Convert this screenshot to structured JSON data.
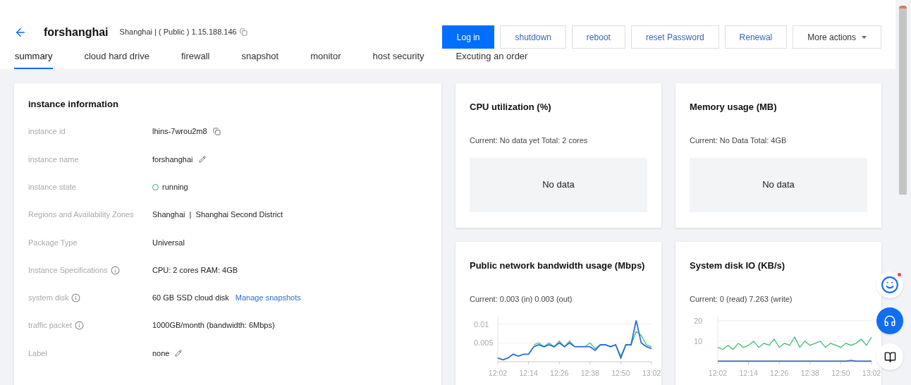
{
  "header": {
    "title": "forshanghai",
    "subtitle": "Shanghai | ( Public ) 1.15.188.146"
  },
  "buttons": [
    {
      "label": "Log in",
      "kind": "primary"
    },
    {
      "label": "shutdown",
      "kind": "outline"
    },
    {
      "label": "reboot",
      "kind": "outline"
    },
    {
      "label": "reset Password",
      "kind": "outline"
    },
    {
      "label": "Renewal",
      "kind": "outline"
    },
    {
      "label": "More actions",
      "kind": "dropdown"
    }
  ],
  "tabs": [
    {
      "label": "summary",
      "selected": true
    },
    {
      "label": "cloud hard drive",
      "selected": false
    },
    {
      "label": "firewall",
      "selected": false
    },
    {
      "label": "snapshot",
      "selected": false
    },
    {
      "label": "monitor",
      "selected": false
    },
    {
      "label": "host security",
      "selected": false
    },
    {
      "label": "Excuting an order",
      "selected": false
    }
  ],
  "instance_info": {
    "title": "instance information",
    "rows": [
      {
        "label": "instance id",
        "info": false,
        "value": "lhins-7wrou2m8",
        "kind": "copyable"
      },
      {
        "label": "instance name",
        "info": false,
        "value": "forshanghai",
        "kind": "editable"
      },
      {
        "label": "instance state",
        "info": false,
        "value": "running",
        "kind": "status"
      },
      {
        "label": "Regions and Availability Zones",
        "info": false,
        "value": "Shanghai  |  Shanghai Second District",
        "kind": "plain"
      },
      {
        "label": "Package Type",
        "info": false,
        "value": "Universal",
        "kind": "plain"
      },
      {
        "label": "Instance Specifications",
        "info": true,
        "value": "CPU: 2 cores RAM: 4GB",
        "kind": "plain"
      },
      {
        "label": "system disk",
        "info": true,
        "value": "60 GB SSD cloud disk",
        "link": "Manage snapshots",
        "kind": "plain"
      },
      {
        "label": "traffic packet",
        "info": true,
        "value": "1000GB/month (bandwidth: 6Mbps)",
        "kind": "plain"
      },
      {
        "label": "Label",
        "info": false,
        "value": "none",
        "kind": "editable"
      }
    ]
  },
  "metrics": [
    {
      "title": "CPU utilization (%)",
      "current": "Current: No data yet Total: 2 cores",
      "empty": "No data"
    },
    {
      "title": "Memory usage (MB)",
      "current": "Current: No Data Total: 4GB",
      "empty": "No data"
    },
    {
      "title": "Public network bandwidth usage (Mbps)",
      "current": "Current: 0.003 (in) 0.003 (out)",
      "chart_data": {
        "type": "line",
        "categories": [
          "12:02",
          null,
          null,
          null,
          null,
          null,
          "12:14",
          null,
          null,
          null,
          null,
          null,
          "12:26",
          null,
          null,
          null,
          null,
          null,
          "12:38",
          null,
          null,
          null,
          null,
          null,
          "12:50",
          null,
          null,
          null,
          null,
          null,
          "13:02"
        ],
        "ylim": [
          0,
          0.012
        ],
        "yticks": [
          {
            "value": 0.005,
            "label": "0.005"
          },
          {
            "value": 0.01,
            "label": "0.01"
          }
        ],
        "series": [
          {
            "color": "#3ebd7a",
            "values": [
              null,
              null,
              null,
              null,
              null,
              null,
              null,
              0.0045,
              0.005,
              0.004,
              0.005,
              0.004,
              0.0055,
              0.004,
              0.0055,
              0.004,
              0.004,
              0.004,
              0.005,
              0.0035,
              0.0045,
              0.0045,
              0.004,
              0.0045,
              0.0015,
              0.0045,
              0.0045,
              0.008,
              0.007,
              0.0045,
              0.004
            ]
          },
          {
            "color": "#2a6fd6",
            "values": [
              0.001,
              0.0005,
              0.001,
              0.002,
              0.0015,
              0.002,
              0.002,
              0.004,
              0.0045,
              0.004,
              0.0045,
              0.004,
              0.005,
              0.004,
              0.005,
              0.004,
              0.004,
              0.004,
              0.004,
              0.003,
              0.0045,
              0.0045,
              0.004,
              0.0045,
              0.001,
              0.0045,
              0.0045,
              0.011,
              0.005,
              0.004,
              0.0035
            ]
          }
        ]
      }
    },
    {
      "title": "System disk IO (KB/s)",
      "current": "Current: 0 (read) 7.263 (write)",
      "chart_data": {
        "type": "line",
        "categories": [
          "12:02",
          null,
          null,
          null,
          null,
          null,
          "12:14",
          null,
          null,
          null,
          null,
          null,
          "12:26",
          null,
          null,
          null,
          null,
          null,
          "12:38",
          null,
          null,
          null,
          null,
          null,
          "12:50",
          null,
          null,
          null,
          null,
          null,
          "13:02"
        ],
        "ylim": [
          0,
          22
        ],
        "yticks": [
          {
            "value": 10,
            "label": "10"
          },
          {
            "value": 20,
            "label": "20"
          }
        ],
        "series": [
          {
            "color": "#3ebd7a",
            "values": [
              7,
              6,
              8,
              6,
              9,
              7,
              8,
              10,
              7,
              9,
              8,
              11,
              7,
              9,
              8,
              12,
              7,
              10,
              8,
              9,
              10,
              7,
              9,
              8,
              7,
              9,
              8,
              9,
              11,
              8,
              12
            ]
          },
          {
            "color": "#4a6fb5",
            "values": [
              0.3,
              0.3,
              0.3,
              0.3,
              0.3,
              0.3,
              0.3,
              0.3,
              0.3,
              0.3,
              0.3,
              0.3,
              0.3,
              0.3,
              0.3,
              0.3,
              0.3,
              0.3,
              0.3,
              0.3,
              0.3,
              0.3,
              0.3,
              0.3,
              0.3,
              0.3,
              0.6,
              0.3,
              0.3,
              0.3,
              0.3
            ]
          }
        ]
      }
    }
  ]
}
